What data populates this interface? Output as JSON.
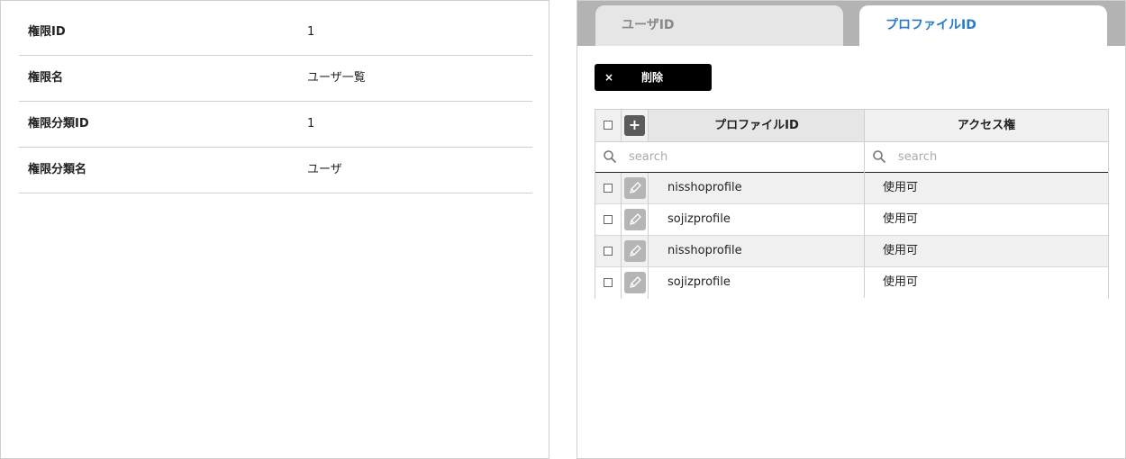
{
  "details": [
    {
      "label": "権限ID",
      "value": "1"
    },
    {
      "label": "権限名",
      "value": "ユーザ一覧"
    },
    {
      "label": "権限分類ID",
      "value": "1"
    },
    {
      "label": "権限分類名",
      "value": "ユーザ"
    }
  ],
  "tabs": [
    {
      "label": "ユーザID",
      "active": false
    },
    {
      "label": "プロファイルID",
      "active": true
    }
  ],
  "toolbar": {
    "delete_icon": "×",
    "delete_label": "削除"
  },
  "grid": {
    "add_icon": "+",
    "columns": {
      "profile_id": "プロファイルID",
      "access": "アクセス権"
    },
    "search": {
      "profile_placeholder": "search",
      "access_placeholder": "search"
    },
    "rows": [
      {
        "profile_id": "nisshoprofile",
        "access": "使用可"
      },
      {
        "profile_id": "sojizprofile",
        "access": "使用可"
      },
      {
        "profile_id": "nisshoprofile",
        "access": "使用可"
      },
      {
        "profile_id": "sojizprofile",
        "access": "使用可"
      }
    ]
  },
  "colors": {
    "active_tab_text": "#2a7ac8",
    "tab_strip": "#b3b3b3",
    "delete_button": "#000000"
  }
}
